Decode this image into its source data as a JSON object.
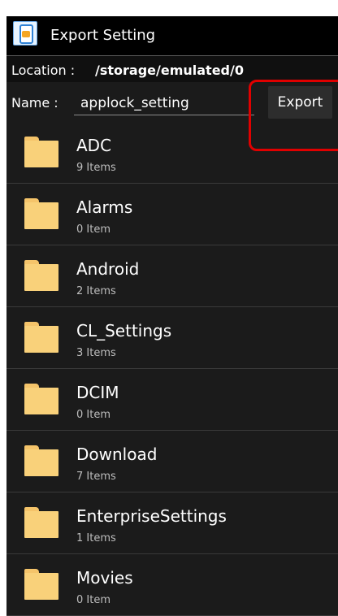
{
  "title": "Export Setting",
  "location": {
    "label": "Location :",
    "path": "/storage/emulated/0"
  },
  "name_field": {
    "label": "Name :",
    "value": "applock_setting"
  },
  "export_button": "Export",
  "folders": [
    {
      "name": "ADC",
      "count": "9 Items"
    },
    {
      "name": "Alarms",
      "count": "0 Item"
    },
    {
      "name": "Android",
      "count": "2 Items"
    },
    {
      "name": "CL_Settings",
      "count": "3 Items"
    },
    {
      "name": "DCIM",
      "count": "0 Item"
    },
    {
      "name": "Download",
      "count": "7 Items"
    },
    {
      "name": "EnterpriseSettings",
      "count": "1 Items"
    },
    {
      "name": "Movies",
      "count": "0 Item"
    }
  ],
  "colors": {
    "background": "#1b1b1b",
    "title_bar": "#000000",
    "folder": "#f9d17a",
    "highlight": "#e00000"
  },
  "icons": {
    "app": "applock-phone-icon",
    "folder": "folder-icon"
  }
}
